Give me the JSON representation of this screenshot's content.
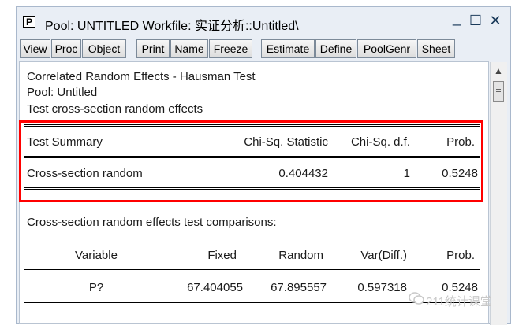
{
  "window": {
    "icon_letter": "P",
    "title": "Pool: UNTITLED   Workfile: 实证分析::Untitled\\",
    "controls": {
      "minimize": "_",
      "maximize": "☐",
      "close": "✕"
    }
  },
  "toolbar": {
    "buttons": [
      "View",
      "Proc",
      "Object",
      "Print",
      "Name",
      "Freeze",
      "Estimate",
      "Define",
      "PoolGenr",
      "Sheet"
    ]
  },
  "output": {
    "heading": "Correlated Random Effects - Hausman Test",
    "pool": "Pool: Untitled",
    "test_desc": "Test cross-section random effects",
    "summary_table": {
      "headers": [
        "Test Summary",
        "Chi-Sq. Statistic",
        "Chi-Sq. d.f.",
        "Prob."
      ],
      "rows": [
        [
          "Cross-section random",
          "0.404432",
          "1",
          "0.5248"
        ]
      ]
    },
    "comparison_title": "Cross-section random effects test comparisons:",
    "comparison_table": {
      "headers": [
        "Variable",
        "Fixed",
        "Random",
        "Var(Diff.)",
        "Prob."
      ],
      "rows": [
        [
          "P?",
          "67.404055",
          "67.895557",
          "0.597318",
          "0.5248"
        ]
      ]
    }
  },
  "watermark": "211统计课堂",
  "colors": {
    "highlight_box": "#ff0000",
    "window_bg": "#e9eef5",
    "title_icon_color": "#1a3a5a"
  }
}
